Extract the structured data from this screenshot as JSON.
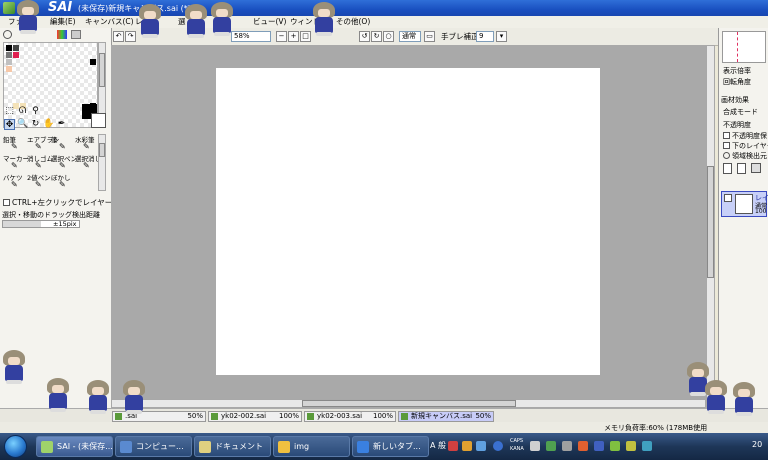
{
  "window": {
    "app_logo": "SAI",
    "title": "(未保存)新規キャンバス.sai (*)"
  },
  "menu": [
    "ファ",
    "編集(E)",
    "キャンバス(C)",
    "レ",
    "選",
    "ビュー(V)",
    "ウィンドウ",
    "その他(O)"
  ],
  "toolbar": {
    "zoom_value": "58%",
    "blend_mode": "通常",
    "stabilizer_label": "手ブレ補正",
    "stabilizer_value": "9"
  },
  "left_panel": {
    "brushes": [
      {
        "label": "鉛筆",
        "icon": "pencil-icon"
      },
      {
        "label": "エアブラシ",
        "icon": "airbrush-icon"
      },
      {
        "label": "筆",
        "icon": "brush-icon"
      },
      {
        "label": "水彩筆",
        "icon": "watercolor-icon"
      },
      {
        "label": "マーカー",
        "icon": "marker-icon"
      },
      {
        "label": "消しゴム",
        "icon": "eraser-icon"
      },
      {
        "label": "選択ペン",
        "icon": "select-pen-icon"
      },
      {
        "label": "選択消し",
        "icon": "select-eraser-icon"
      },
      {
        "label": "バケツ",
        "icon": "bucket-icon"
      },
      {
        "label": "2値ペン",
        "icon": "binary-pen-icon"
      },
      {
        "label": "ぼかし",
        "icon": "blur-icon"
      }
    ],
    "ctrl_option": "CTRL+左クリックでレイヤー選択",
    "drag_label": "選択・移動のドラッグ検出距離",
    "drag_value": "±15pix"
  },
  "right_panel": {
    "display_scale": "表示倍率",
    "rotation": "回転角度",
    "paper_effect": "画材効果",
    "blend_mode_label": "合成モード",
    "opacity_label": "不透明度",
    "protect_opacity": "不透明度保",
    "clip_lower": "下のレイヤーで",
    "detect_source": "領域検出元",
    "layer_name": "レイ",
    "layer_mode": "通常",
    "layer_opacity": "100"
  },
  "doc_tabs": [
    {
      "name": ".sai",
      "pct": "50%",
      "active": false
    },
    {
      "name": "yk02-002.sai",
      "pct": "100%",
      "active": false
    },
    {
      "name": "yk02-003.sai",
      "pct": "100%",
      "active": false
    },
    {
      "name": "新規キャンバス.sai",
      "pct": "50%",
      "active": true
    }
  ],
  "status": {
    "memory": "メモリ負荷率:60% (178MB使用"
  },
  "taskbar": {
    "items": [
      {
        "label": "SAI - (未保存...",
        "active": true
      },
      {
        "label": "コンピュー...",
        "active": false
      },
      {
        "label": "ドキュメント",
        "active": false
      },
      {
        "label": "img",
        "active": false
      },
      {
        "label": "新しいタブ...",
        "active": false
      }
    ],
    "lang": "A 般",
    "caps": "CAPS",
    "kana": "KANA",
    "clock": "20"
  },
  "colors": {
    "titlebar": "#1a50c0",
    "canvas_bg": "#a9a9a9",
    "canvas": "#ffffff",
    "mascot_body": "#3340a0"
  }
}
